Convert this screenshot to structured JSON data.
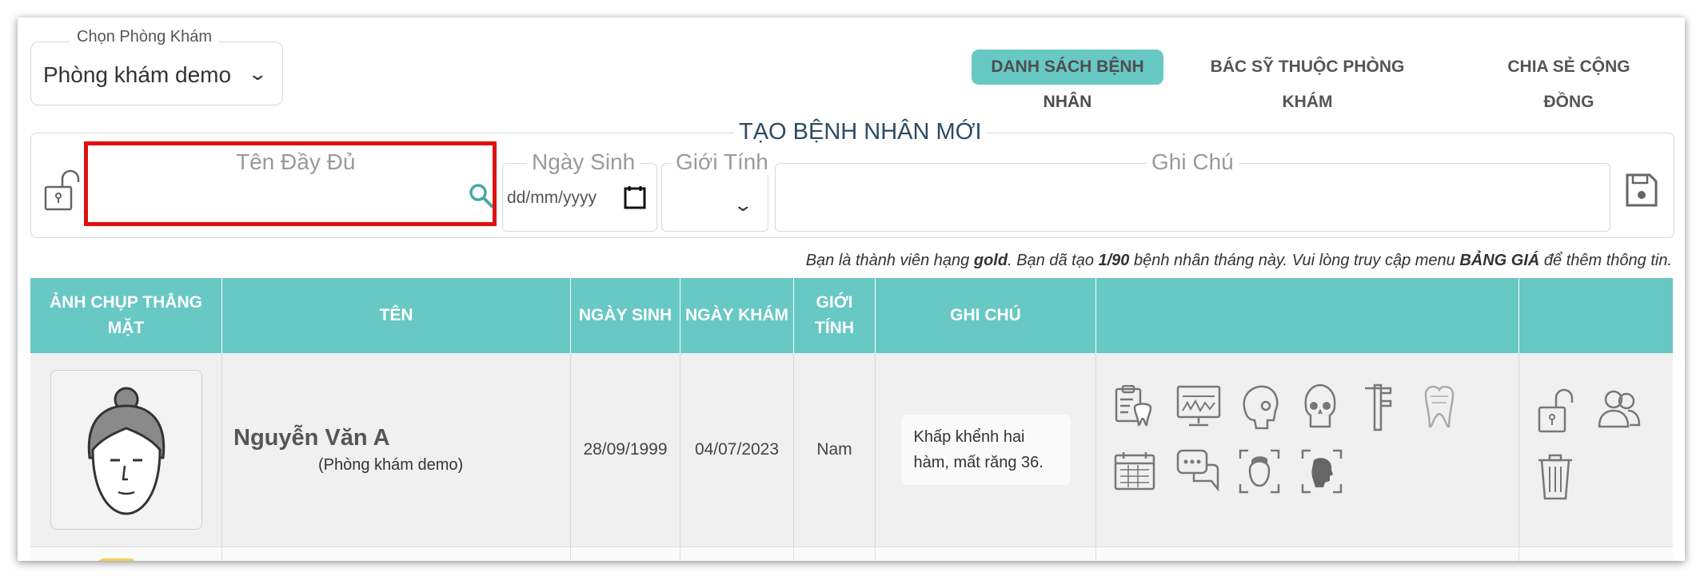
{
  "clinic_selector": {
    "legend": "Chọn Phòng Khám",
    "value": "Phòng khám demo"
  },
  "nav": {
    "patient_list": "DANH SÁCH BỆNH NHÂN",
    "clinic_doctors": "BÁC SỸ THUỘC PHÒNG KHÁM",
    "community_share": "CHIA SẺ CỘNG ĐỒNG"
  },
  "create_form": {
    "title": "TẠO BỆNH NHÂN MỚI",
    "full_name_label": "Tên Đầy Đủ",
    "dob_label": "Ngày Sinh",
    "dob_placeholder": "dd/mm/yyyy",
    "gender_label": "Giới Tính",
    "note_label": "Ghi Chú"
  },
  "info_line": {
    "prefix": "Bạn là thành viên hạng ",
    "tier": "gold",
    "middle": ".  Bạn dã tạo ",
    "count": "1/90",
    "middle2": " bệnh nhân tháng này.  Vui lòng truy cập menu ",
    "menu": "BẢNG GIÁ",
    "suffix": " để thêm thông tin."
  },
  "table": {
    "headers": {
      "photo": "ẢNH CHỤP THẲNG MẶT",
      "name": "TÊN",
      "dob": "NGÀY SINH",
      "visit_date": "NGÀY KHÁM",
      "gender": "GIỚI TÍNH",
      "note": "GHI CHÚ"
    },
    "rows": [
      {
        "name": "Nguyễn Văn A",
        "clinic": "(Phòng khám demo)",
        "dob": "28/09/1999",
        "visit_date": "04/07/2023",
        "gender": "Nam",
        "note": "Khấp khểnh hai hàm, mất răng 36."
      }
    ]
  },
  "icons": {
    "row_tools": [
      "dental-chart-icon",
      "xray-monitor-icon",
      "skull-side-icon",
      "skull-front-icon",
      "caliper-icon",
      "tooth-icon",
      "calendar-icon",
      "chat-icon",
      "face-scan-icon",
      "profile-scan-icon"
    ],
    "row_actions": [
      "unlock-icon",
      "share-users-icon",
      "trash-icon"
    ]
  },
  "colors": {
    "accent": "#68c8c4",
    "highlight_border": "#e01010"
  }
}
